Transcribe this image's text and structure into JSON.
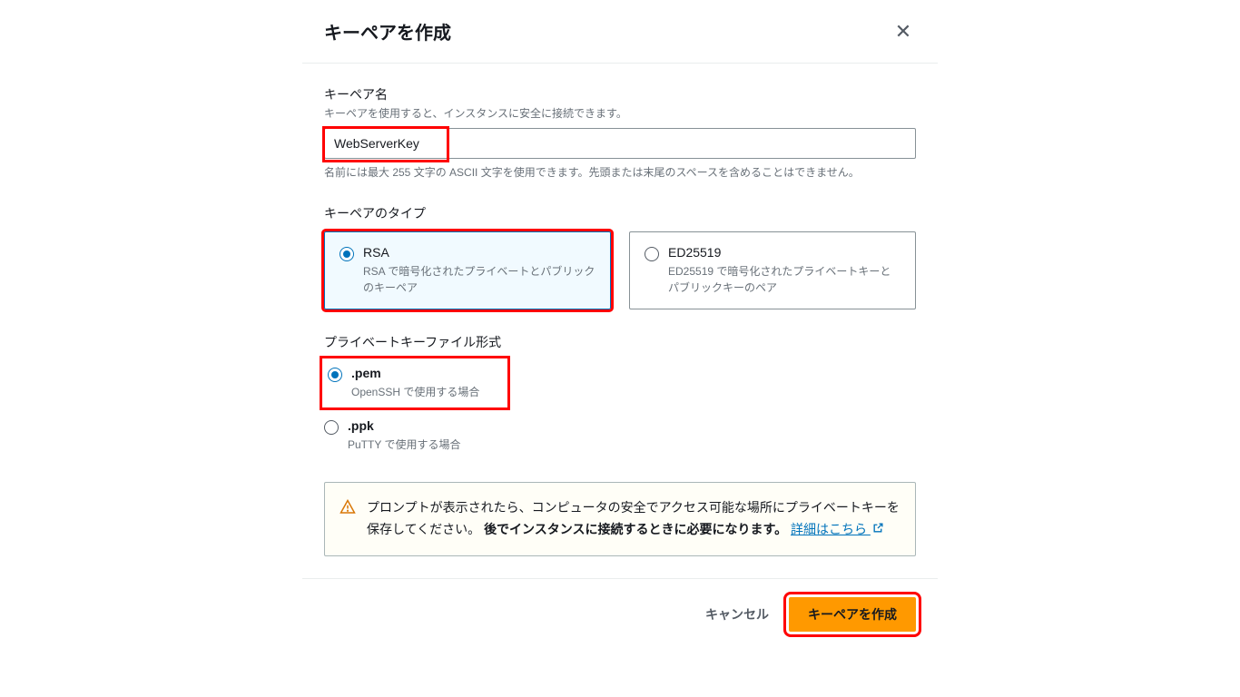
{
  "modal": {
    "title": "キーペアを作成",
    "close_label": "✕"
  },
  "name_field": {
    "label": "キーペア名",
    "description": "キーペアを使用すると、インスタンスに安全に接続できます。",
    "value": "WebServerKey",
    "hint": "名前には最大 255 文字の ASCII 文字を使用できます。先頭または末尾のスペースを含めることはできません。"
  },
  "type_field": {
    "label": "キーペアのタイプ",
    "options": {
      "rsa": {
        "title": "RSA",
        "desc": "RSA で暗号化されたプライベートとパブリックのキーペア"
      },
      "ed25519": {
        "title": "ED25519",
        "desc": "ED25519 で暗号化されたプライベートキーとパブリックキーのペア"
      }
    }
  },
  "format_field": {
    "label": "プライベートキーファイル形式",
    "options": {
      "pem": {
        "title": ".pem",
        "desc": "OpenSSH で使用する場合"
      },
      "ppk": {
        "title": ".ppk",
        "desc": "PuTTY で使用する場合"
      }
    }
  },
  "alert": {
    "text1": "プロンプトが表示されたら、コンピュータの安全でアクセス可能な場所にプライベートキーを保存してください。",
    "bold": "後でインスタンスに接続するときに必要になります。",
    "link": "詳細はこちら"
  },
  "footer": {
    "cancel": "キャンセル",
    "submit": "キーペアを作成"
  }
}
